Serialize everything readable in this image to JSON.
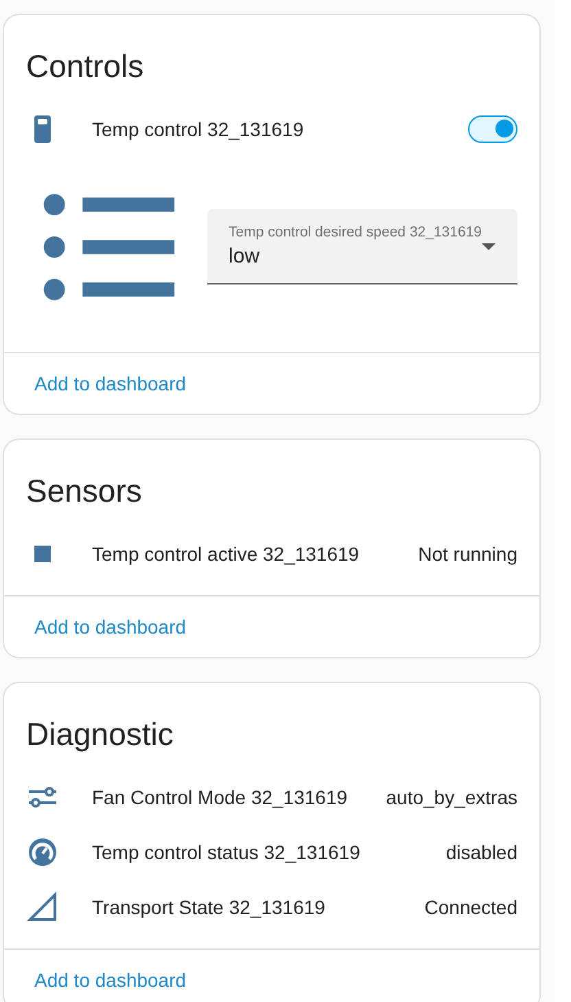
{
  "cards": [
    {
      "title": "Controls",
      "rows": [
        {
          "kind": "toggle",
          "label": "Temp control 32_131619",
          "on": true
        },
        {
          "kind": "select",
          "label": "Temp control desired speed 32_131619",
          "value": "low"
        }
      ],
      "action": "Add to dashboard"
    },
    {
      "title": "Sensors",
      "rows": [
        {
          "kind": "state",
          "label": "Temp control active 32_131619",
          "value": "Not running"
        }
      ],
      "action": "Add to dashboard"
    },
    {
      "title": "Diagnostic",
      "rows": [
        {
          "kind": "state",
          "label": "Fan Control Mode 32_131619",
          "value": "auto_by_extras"
        },
        {
          "kind": "state",
          "label": "Temp control status 32_131619",
          "value": "disabled"
        },
        {
          "kind": "state",
          "label": "Transport State 32_131619",
          "value": "Connected"
        }
      ],
      "action": "Add to dashboard"
    }
  ]
}
